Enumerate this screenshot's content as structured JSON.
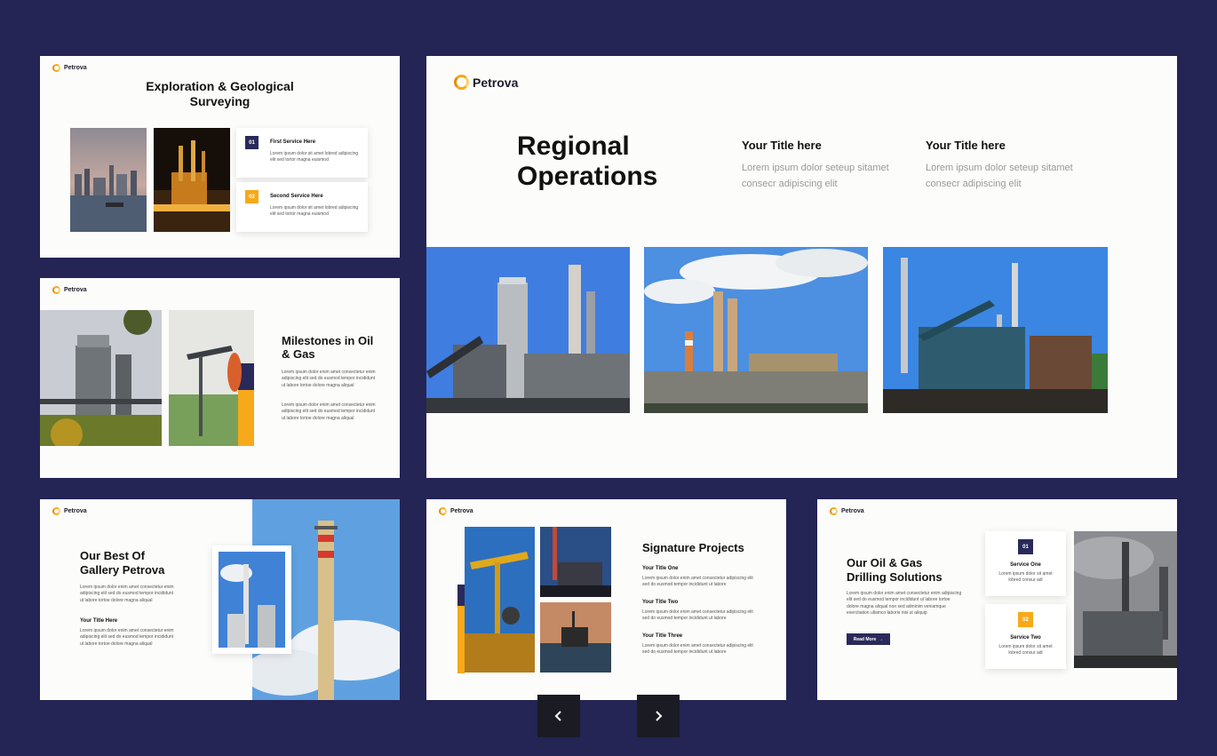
{
  "brand": "Petrova",
  "colors": {
    "background": "#242455",
    "accent": "#f6a91a",
    "navy": "#2a2a5a"
  },
  "slide1": {
    "title": "Exploration & Geological Surveying",
    "services": [
      {
        "num": "01",
        "title": "First Service Here",
        "text": "Lorem ipsum dolor sit amet lobred adipiscing elit sed tortor magna euismod"
      },
      {
        "num": "02",
        "title": "Second Service Here",
        "text": "Lorem ipsum dolor sit amet lobred adipiscing elit sed tortor magna euismod"
      }
    ]
  },
  "slide2": {
    "title": "Milestones in Oil & Gas",
    "para1": "Lorem ipsum dolor enim amet consectetur enim adipiscing elit sed do eusmod tempor incididunt ut labore tortoe dolore magna aliqual",
    "para2": "Lorem ipsum dolor enim amet consectetur enim adipiscing elit sed do eusmod tempor incididunt ut labore tortoe dolore magna aliqual"
  },
  "slide_main": {
    "title": "Regional Operations",
    "cols": [
      {
        "title": "Your Title here",
        "text": "Lorem ipsum dolor seteup sitamet consecr adipiscing elit"
      },
      {
        "title": "Your Title here",
        "text": "Lorem ipsum dolor seteup sitamet consecr adipiscing elit"
      }
    ]
  },
  "slide4": {
    "title": "Our Best Of Gallery Petrova",
    "para1": "Lorem ipsum dolor enim amet consectetur enim adipiscing elit sed do eusmod tempor incididunt ut labore tortoe dolore magna aliqual",
    "subtitle": "Your Title Here",
    "para2": "Lorem ipsum dolor enim amet consectetur enim adipiscing elit sed do eusmod tempor incididunt ut labore tortoe dolore magna aliqual"
  },
  "slide5": {
    "title": "Signature Projects",
    "items": [
      {
        "title": "Your Title One",
        "text": "Lorem ipsum dolor enim amet consectetur adipiscing elit sed do eusmod tempor incididunt ut labore"
      },
      {
        "title": "Your Title Two",
        "text": "Lorem ipsum dolor enim amet consectetur adipiscing elit sed do eusmod tempor incididunt ut labore"
      },
      {
        "title": "Your Title Three",
        "text": "Lorem ipsum dolor enim amet consectetur adipiscing elit sed do eusmod tempor incididunt ut labore"
      }
    ]
  },
  "slide6": {
    "title": "Our Oil & Gas Drilling Solutions",
    "para": "Lorem ipsum dolor enim amet consectetur enim adipiscing elit sed do eusmod tempor incididunt ut labore tortoe dolore magna aliqual non sed adminim veniamque exercitation ullamco laboris nisi ut aliquip",
    "button": "Read More",
    "services": [
      {
        "num": "01",
        "title": "Service One",
        "text": "Lorem ipsum dolor sit amet lobred consur adi"
      },
      {
        "num": "02",
        "title": "Service Two",
        "text": "Lorem ipsum dolor sit amet lobred consur adi"
      }
    ]
  },
  "nav": {
    "prev_icon": "chevron-left-icon",
    "next_icon": "chevron-right-icon"
  }
}
